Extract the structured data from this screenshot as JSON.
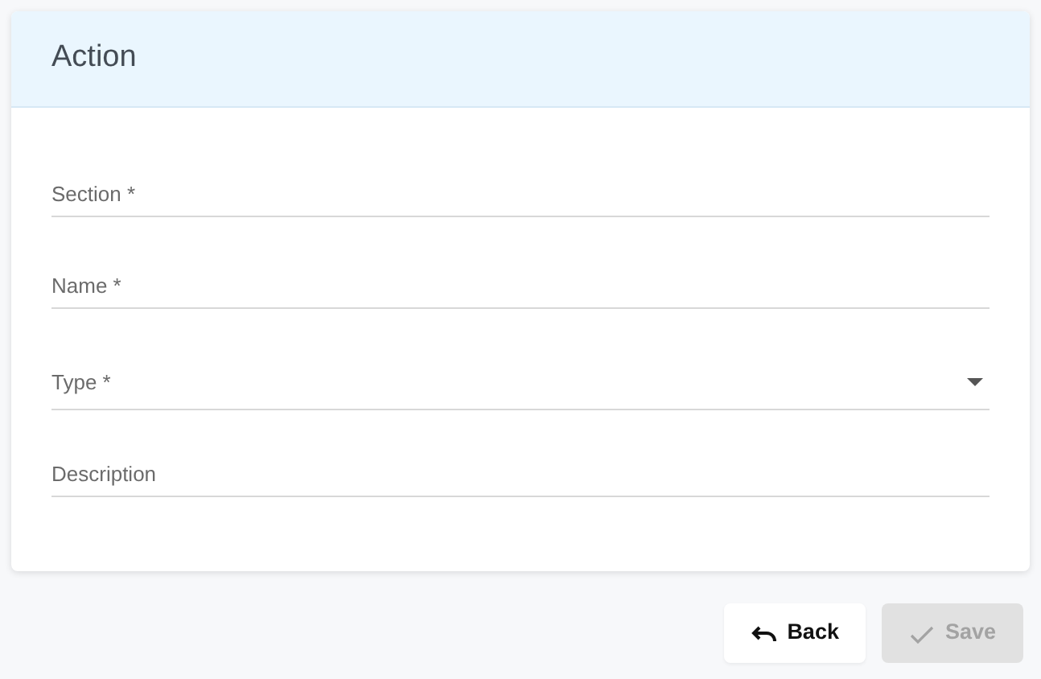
{
  "card": {
    "title": "Action"
  },
  "fields": [
    {
      "kind": "text",
      "placeholder": "Section *"
    },
    {
      "kind": "text",
      "placeholder": "Name *"
    },
    {
      "kind": "select",
      "placeholder": "Type *"
    },
    {
      "kind": "text",
      "placeholder": "Description"
    }
  ],
  "buttons": [
    {
      "kind": "back",
      "label": "Back",
      "disabled": false
    },
    {
      "kind": "save",
      "label": "Save",
      "disabled": true
    }
  ]
}
